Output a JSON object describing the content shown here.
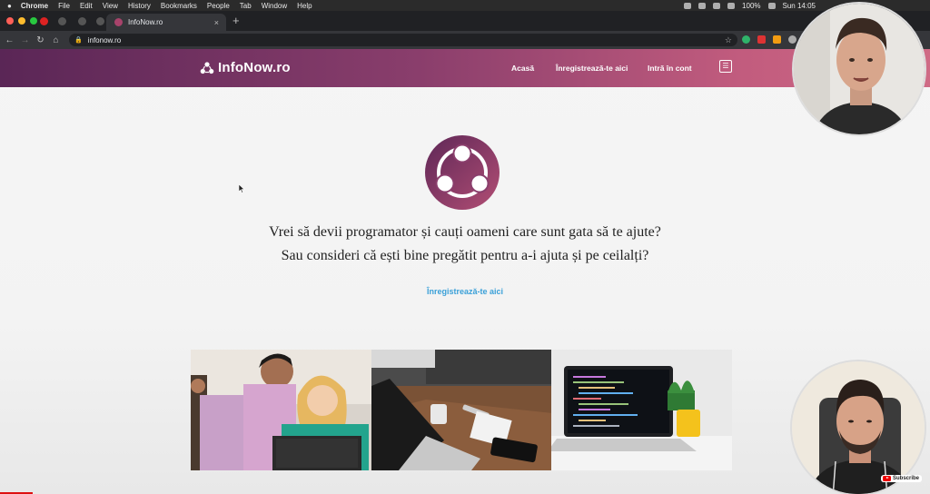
{
  "macos_menubar": {
    "app_name": "Chrome",
    "items": [
      "File",
      "Edit",
      "View",
      "History",
      "Bookmarks",
      "People",
      "Tab",
      "Window",
      "Help"
    ],
    "battery": "100%",
    "clock": "Sun 14:05"
  },
  "browser": {
    "active_tab_title": "InfoNow.ro",
    "close_tab": "×",
    "new_tab": "+",
    "url": "infonow.ro"
  },
  "site": {
    "brand": "InfoNow.ro",
    "nav": {
      "home": "Acasă",
      "register": "Înregistrează-te aici",
      "login": "Intră în cont"
    },
    "tagline_line1": "Vrei să devii programator și cauți oameni care sunt gata să te ajute?",
    "tagline_line2": "Sau consideri că ești bine pregătit pentru a-i ajuta și pe ceilalți?",
    "cta_link": "Înregistrează-te aici",
    "accent_color": "#8a3e6c",
    "link_color": "#3aa0d8"
  },
  "overlay": {
    "subscribe_label": "Subscribe"
  }
}
